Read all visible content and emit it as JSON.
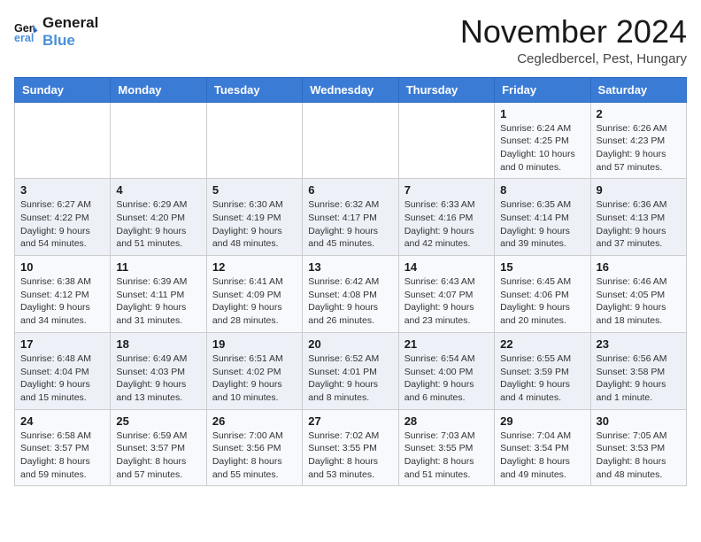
{
  "logo": {
    "line1": "General",
    "line2": "Blue"
  },
  "title": "November 2024",
  "location": "Cegledbercel, Pest, Hungary",
  "days_header": [
    "Sunday",
    "Monday",
    "Tuesday",
    "Wednesday",
    "Thursday",
    "Friday",
    "Saturday"
  ],
  "weeks": [
    [
      {
        "day": "",
        "info": ""
      },
      {
        "day": "",
        "info": ""
      },
      {
        "day": "",
        "info": ""
      },
      {
        "day": "",
        "info": ""
      },
      {
        "day": "",
        "info": ""
      },
      {
        "day": "1",
        "info": "Sunrise: 6:24 AM\nSunset: 4:25 PM\nDaylight: 10 hours\nand 0 minutes."
      },
      {
        "day": "2",
        "info": "Sunrise: 6:26 AM\nSunset: 4:23 PM\nDaylight: 9 hours\nand 57 minutes."
      }
    ],
    [
      {
        "day": "3",
        "info": "Sunrise: 6:27 AM\nSunset: 4:22 PM\nDaylight: 9 hours\nand 54 minutes."
      },
      {
        "day": "4",
        "info": "Sunrise: 6:29 AM\nSunset: 4:20 PM\nDaylight: 9 hours\nand 51 minutes."
      },
      {
        "day": "5",
        "info": "Sunrise: 6:30 AM\nSunset: 4:19 PM\nDaylight: 9 hours\nand 48 minutes."
      },
      {
        "day": "6",
        "info": "Sunrise: 6:32 AM\nSunset: 4:17 PM\nDaylight: 9 hours\nand 45 minutes."
      },
      {
        "day": "7",
        "info": "Sunrise: 6:33 AM\nSunset: 4:16 PM\nDaylight: 9 hours\nand 42 minutes."
      },
      {
        "day": "8",
        "info": "Sunrise: 6:35 AM\nSunset: 4:14 PM\nDaylight: 9 hours\nand 39 minutes."
      },
      {
        "day": "9",
        "info": "Sunrise: 6:36 AM\nSunset: 4:13 PM\nDaylight: 9 hours\nand 37 minutes."
      }
    ],
    [
      {
        "day": "10",
        "info": "Sunrise: 6:38 AM\nSunset: 4:12 PM\nDaylight: 9 hours\nand 34 minutes."
      },
      {
        "day": "11",
        "info": "Sunrise: 6:39 AM\nSunset: 4:11 PM\nDaylight: 9 hours\nand 31 minutes."
      },
      {
        "day": "12",
        "info": "Sunrise: 6:41 AM\nSunset: 4:09 PM\nDaylight: 9 hours\nand 28 minutes."
      },
      {
        "day": "13",
        "info": "Sunrise: 6:42 AM\nSunset: 4:08 PM\nDaylight: 9 hours\nand 26 minutes."
      },
      {
        "day": "14",
        "info": "Sunrise: 6:43 AM\nSunset: 4:07 PM\nDaylight: 9 hours\nand 23 minutes."
      },
      {
        "day": "15",
        "info": "Sunrise: 6:45 AM\nSunset: 4:06 PM\nDaylight: 9 hours\nand 20 minutes."
      },
      {
        "day": "16",
        "info": "Sunrise: 6:46 AM\nSunset: 4:05 PM\nDaylight: 9 hours\nand 18 minutes."
      }
    ],
    [
      {
        "day": "17",
        "info": "Sunrise: 6:48 AM\nSunset: 4:04 PM\nDaylight: 9 hours\nand 15 minutes."
      },
      {
        "day": "18",
        "info": "Sunrise: 6:49 AM\nSunset: 4:03 PM\nDaylight: 9 hours\nand 13 minutes."
      },
      {
        "day": "19",
        "info": "Sunrise: 6:51 AM\nSunset: 4:02 PM\nDaylight: 9 hours\nand 10 minutes."
      },
      {
        "day": "20",
        "info": "Sunrise: 6:52 AM\nSunset: 4:01 PM\nDaylight: 9 hours\nand 8 minutes."
      },
      {
        "day": "21",
        "info": "Sunrise: 6:54 AM\nSunset: 4:00 PM\nDaylight: 9 hours\nand 6 minutes."
      },
      {
        "day": "22",
        "info": "Sunrise: 6:55 AM\nSunset: 3:59 PM\nDaylight: 9 hours\nand 4 minutes."
      },
      {
        "day": "23",
        "info": "Sunrise: 6:56 AM\nSunset: 3:58 PM\nDaylight: 9 hours\nand 1 minute."
      }
    ],
    [
      {
        "day": "24",
        "info": "Sunrise: 6:58 AM\nSunset: 3:57 PM\nDaylight: 8 hours\nand 59 minutes."
      },
      {
        "day": "25",
        "info": "Sunrise: 6:59 AM\nSunset: 3:57 PM\nDaylight: 8 hours\nand 57 minutes."
      },
      {
        "day": "26",
        "info": "Sunrise: 7:00 AM\nSunset: 3:56 PM\nDaylight: 8 hours\nand 55 minutes."
      },
      {
        "day": "27",
        "info": "Sunrise: 7:02 AM\nSunset: 3:55 PM\nDaylight: 8 hours\nand 53 minutes."
      },
      {
        "day": "28",
        "info": "Sunrise: 7:03 AM\nSunset: 3:55 PM\nDaylight: 8 hours\nand 51 minutes."
      },
      {
        "day": "29",
        "info": "Sunrise: 7:04 AM\nSunset: 3:54 PM\nDaylight: 8 hours\nand 49 minutes."
      },
      {
        "day": "30",
        "info": "Sunrise: 7:05 AM\nSunset: 3:53 PM\nDaylight: 8 hours\nand 48 minutes."
      }
    ]
  ]
}
